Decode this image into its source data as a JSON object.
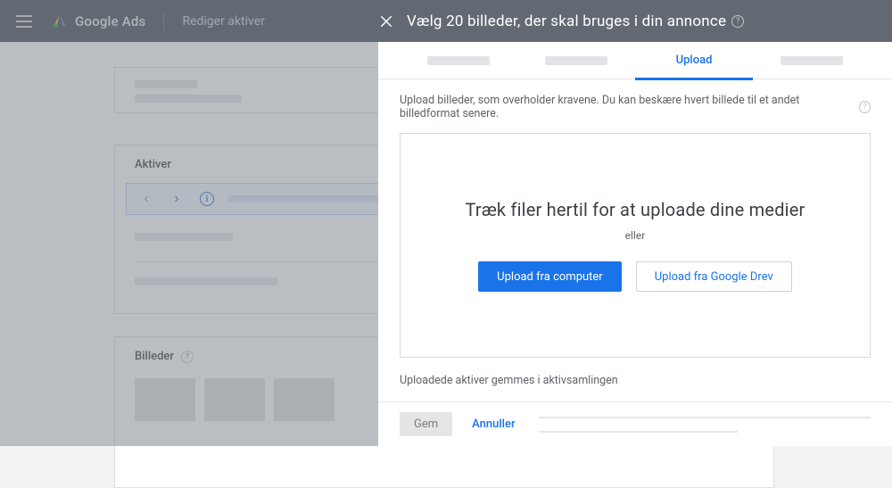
{
  "header": {
    "product": "Google Ads",
    "section": "Rediger aktiver"
  },
  "panel": {
    "title": "Vælg 20 billeder, der skal bruges  i din annonce",
    "tabs": {
      "active": "Upload"
    },
    "helper": "Upload billeder, som overholder kravene. Du kan beskære hvert billede til et andet billedformat senere.",
    "dropzone": {
      "heading": "Træk filer hertil for at uploade dine medier",
      "or": "eller",
      "btn_computer": "Upload fra computer",
      "btn_drive": "Upload fra Google Drev"
    },
    "saved_note": "Uploadede aktiver gemmes  i aktivsamlingen",
    "footer": {
      "save": "Gem",
      "cancel": "Annuller"
    }
  },
  "back": {
    "section_assets": "Aktiver",
    "section_images": "Billeder"
  }
}
